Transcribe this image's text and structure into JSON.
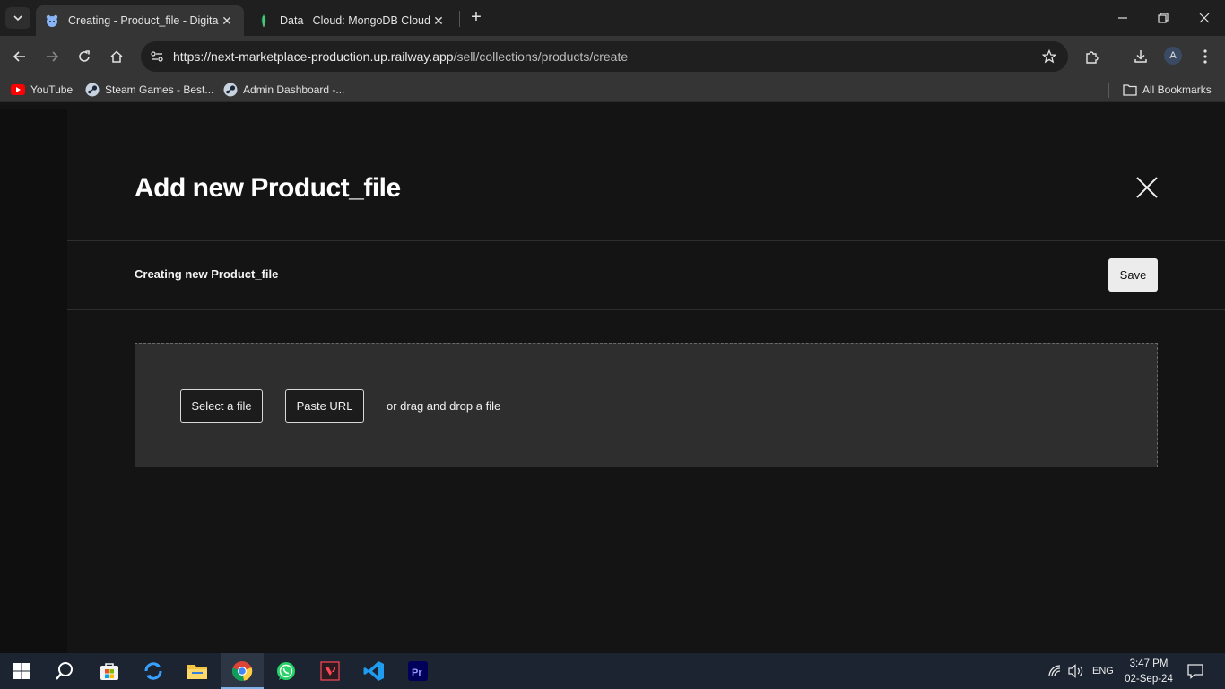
{
  "browser": {
    "tabs": [
      {
        "title": "Creating - Product_file - Digital",
        "active": true
      },
      {
        "title": "Data | Cloud: MongoDB Cloud",
        "active": false
      }
    ],
    "url_host": "https://next-marketplace-production.up.railway.app",
    "url_path": "/sell/collections/products/create",
    "profile_initial": "A",
    "bookmarks": [
      {
        "label": "YouTube",
        "icon": "youtube-icon"
      },
      {
        "label": "Steam Games - Best...",
        "icon": "steam-icon"
      },
      {
        "label": "Admin Dashboard -...",
        "icon": "steam-icon"
      }
    ],
    "all_bookmarks_label": "All Bookmarks"
  },
  "page": {
    "title": "Add new Product_file",
    "subheader": "Creating new Product_file",
    "save_label": "Save",
    "dropzone": {
      "select_file_label": "Select a file",
      "paste_url_label": "Paste URL",
      "drag_text": "or drag and drop a file"
    }
  },
  "taskbar": {
    "apps": [
      "start-icon",
      "search-icon",
      "store-icon",
      "sync-icon",
      "file-explorer-icon",
      "chrome-icon",
      "whatsapp-icon",
      "valorant-icon",
      "vscode-icon",
      "premiere-icon"
    ],
    "active_app": "chrome-icon",
    "language": "ENG",
    "time": "3:47 PM",
    "date": "02-Sep-24"
  }
}
